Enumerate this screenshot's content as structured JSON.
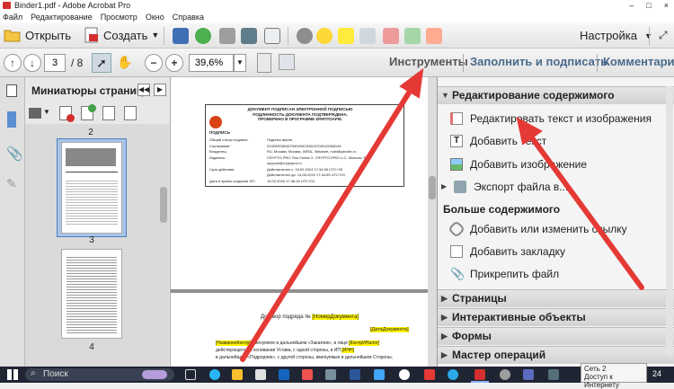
{
  "window": {
    "title": "Binder1.pdf - Adobe Acrobat Pro",
    "controls": [
      "–",
      "□",
      "×"
    ]
  },
  "menubar": [
    "Файл",
    "Редактирование",
    "Просмотр",
    "Окно",
    "Справка"
  ],
  "toolbar": {
    "open_label": "Открыть",
    "create_label": "Создать",
    "settings_label": "Настройка"
  },
  "navbar": {
    "page_value": "3",
    "page_total": "/ 8",
    "zoom_value": "39,6%",
    "tabs": [
      "Инструменты",
      "Заполнить и подписать",
      "Комментари"
    ]
  },
  "leftpanel": {
    "title": "Миниатюры страниц",
    "page_numbers": [
      "2",
      "3",
      "4"
    ]
  },
  "document": {
    "page1_header": [
      "ДОКУМЕНТ ПОДПИСАН ЭЛЕКТРОННОЙ ПОДПИСЬЮ",
      "ПОДЛИННОСТЬ ДОКУМЕНТА ПОДТВЕРЖДЕНА.",
      "ПРОВЕРЕНО В ПРОГРАММЕ КРИПТОАРМ."
    ],
    "signature_label": "ПОДПИСЬ",
    "rows": [
      [
        "Общий статус подписи:",
        "Подпись верна"
      ],
      [
        "Сертификат:",
        "01000303A5D7940090C53615700010084D43"
      ],
      [
        "Владелец:",
        "RU, Москва, Москва, WEBL, Betamet, nobl@yandex.ru"
      ],
      [
        "Издатель:",
        "CRYPTO-PRO Test Center 2, CRYPTO-PRO LLC, Moscow, RU,"
      ],
      [
        "",
        "support@cryptopro.ru"
      ],
      [
        "Срок действия:",
        "Действителен с: 16.02.2024 17:34:55 UTC+03"
      ],
      [
        "",
        "Действителен до: 14.05.2024 17:44:55 UTC+03"
      ],
      [
        "Дата и время создания ЭП:",
        "15.02.2024 17:46:16 UTC+03"
      ]
    ],
    "contract_title": "Договор подряда №",
    "contract_number_tag": "[НомерДокумента]",
    "date_tag": "[ДатаДокумента]",
    "para_tags": [
      "[НазваниеКонтр]",
      "[КонтрИНалог]",
      "[ИНН]"
    ],
    "para_text": [
      "именуемое в дальнейшем «Заказчик», в лице",
      "действующего на основании Устава, с одной стороны, и ИП",
      "в дальнейшем «Подрядчик», с другой стороны, именуемые в дальнейшем Стороны,"
    ]
  },
  "rightpanel": {
    "sections": {
      "edit_content": "Редактирование содержимого",
      "more_content": "Больше содержимого",
      "pages": "Страницы",
      "interactive": "Интерактивные объекты",
      "forms": "Формы",
      "action_wizard": "Мастер операций"
    },
    "edit_items": [
      "Редактировать текст и изображения",
      "Добавить текст",
      "Добавить изображение",
      "Экспорт файла в..."
    ],
    "more_items": [
      "Добавить или изменить ссылку",
      "Добавить закладку",
      "Прикрепить файл"
    ]
  },
  "taskbar": {
    "search_label": "Поиск",
    "network_label": "Сеть 2",
    "network_status": "Доступ к Интернету",
    "clock": "24"
  },
  "colors": {
    "arrow": "#e53935",
    "taskbar": "#1f2532",
    "tab_active": "#555555",
    "highlight": "#fff200"
  }
}
